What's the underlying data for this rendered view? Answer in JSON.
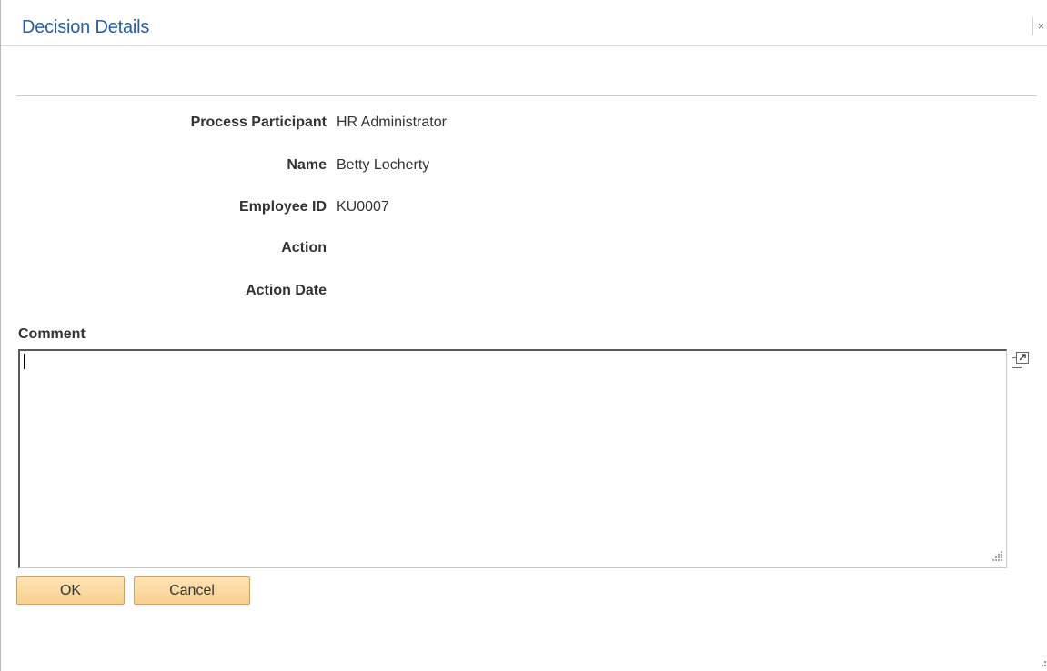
{
  "dialog": {
    "title": "Decision Details",
    "close_glyph": "×"
  },
  "fields": [
    {
      "label": "Process Participant",
      "value": "HR Administrator"
    },
    {
      "label": "Name",
      "value": "Betty Locherty"
    },
    {
      "label": "Employee ID",
      "value": "KU0007"
    },
    {
      "label": "Action",
      "value": ""
    },
    {
      "label": "Action Date",
      "value": ""
    }
  ],
  "comment": {
    "label": "Comment",
    "value": ""
  },
  "buttons": {
    "ok_label": "OK",
    "cancel_label": "Cancel"
  },
  "colors": {
    "title": "#2a5d9a",
    "button_fill": "#f8cf8e",
    "button_border": "#c9a26b"
  },
  "icons": {
    "close": "close-icon",
    "expand": "expand-text-icon",
    "resize": "resize-grip-icon"
  }
}
